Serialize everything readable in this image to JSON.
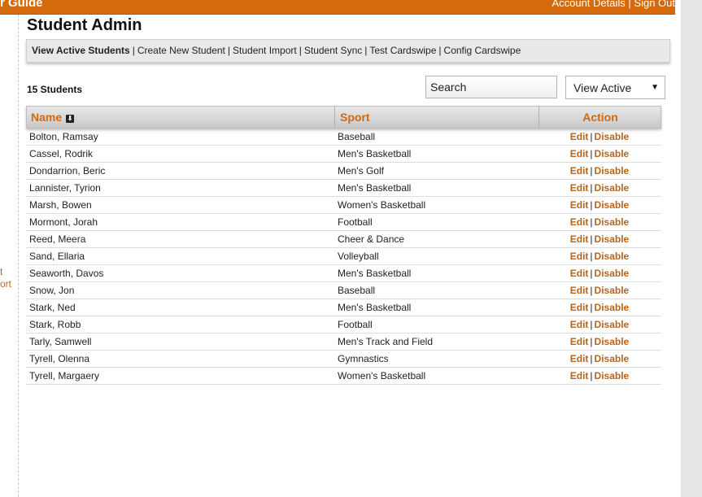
{
  "header": {
    "brand_fragment": "r Guide",
    "account_link": "Account Details",
    "account_sep": "|",
    "signout_link": "Sign Out"
  },
  "sidebar": {
    "fragment1": "t",
    "fragment2": "ort"
  },
  "page": {
    "title": "Student Admin"
  },
  "subnav": {
    "items": [
      {
        "label": "View Active Students",
        "active": true
      },
      {
        "label": "Create New Student"
      },
      {
        "label": "Student Import"
      },
      {
        "label": "Student Sync"
      },
      {
        "label": "Test Cardswipe"
      },
      {
        "label": "Config Cardswipe"
      }
    ],
    "sep": "|"
  },
  "toolbar": {
    "count_label": "15 Students",
    "search_placeholder": "Search",
    "filter_value": "View Active",
    "filter_arrow": "▼"
  },
  "table": {
    "headers": {
      "name": "Name",
      "sport": "Sport",
      "action": "Action"
    },
    "sort_icon": "⬇",
    "edit_label": "Edit",
    "disable_label": "Disable",
    "action_sep": "|",
    "rows": [
      {
        "name": "Bolton, Ramsay",
        "sport": "Baseball"
      },
      {
        "name": "Cassel, Rodrik",
        "sport": "Men's Basketball"
      },
      {
        "name": "Dondarrion, Beric",
        "sport": "Men's Golf"
      },
      {
        "name": "Lannister, Tyrion",
        "sport": "Men's Basketball"
      },
      {
        "name": "Marsh, Bowen",
        "sport": "Women's Basketball"
      },
      {
        "name": "Mormont, Jorah",
        "sport": "Football"
      },
      {
        "name": "Reed, Meera",
        "sport": "Cheer & Dance"
      },
      {
        "name": "Sand, Ellaria",
        "sport": "Volleyball"
      },
      {
        "name": "Seaworth, Davos",
        "sport": "Men's Basketball"
      },
      {
        "name": "Snow, Jon",
        "sport": "Baseball"
      },
      {
        "name": "Stark, Ned",
        "sport": "Men's Basketball"
      },
      {
        "name": "Stark, Robb",
        "sport": "Football"
      },
      {
        "name": "Tarly, Samwell",
        "sport": "Men's Track and Field"
      },
      {
        "name": "Tyrell, Olenna",
        "sport": "Gymnastics"
      },
      {
        "name": "Tyrell, Margaery",
        "sport": "Women's Basketball"
      }
    ]
  },
  "colors": {
    "accent": "#d46a0c",
    "link": "#b5651d"
  }
}
